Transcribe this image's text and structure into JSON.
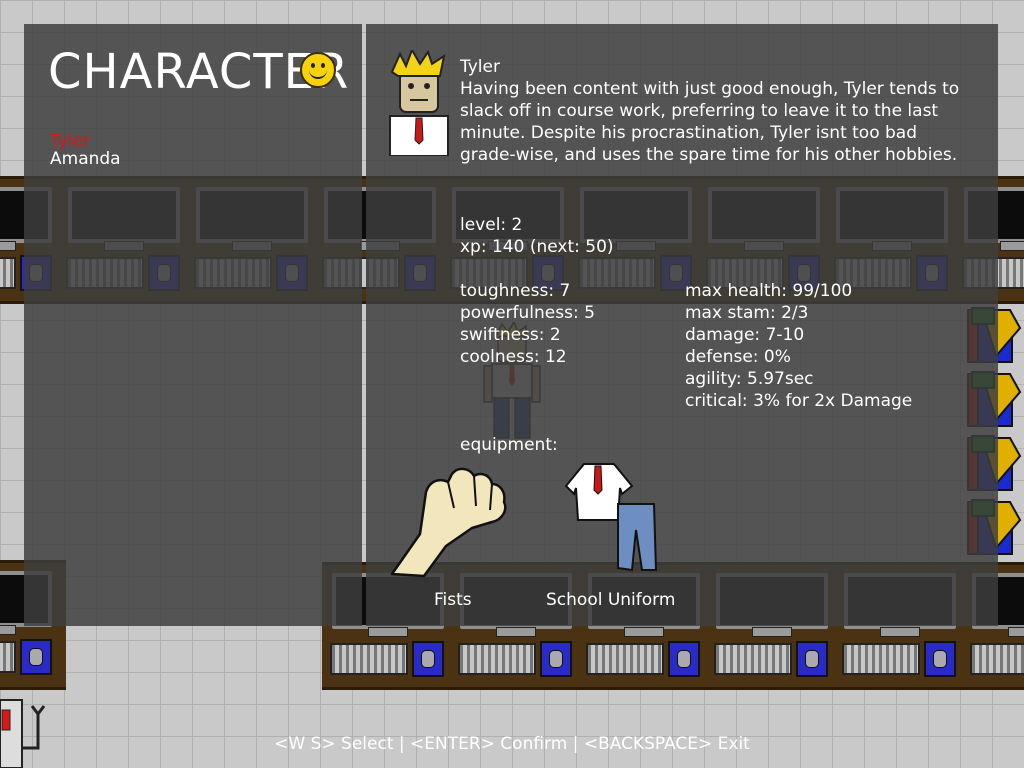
{
  "title": "CHARACTER",
  "characters": {
    "selected": "Tyler",
    "other": "Amanda"
  },
  "profile": {
    "name": "Tyler",
    "description": "Having been content with just good enough, Tyler tends to slack off in course work, preferring to leave it to the last minute. Despite his procrastination, Tyler isnt too bad grade-wise, and uses the spare time for his other hobbies."
  },
  "progress": {
    "level": "level: 2",
    "xp": "xp: 140 (next: 50)"
  },
  "attributes": [
    "toughness: 7",
    "powerfulness: 5",
    "swiftness: 2",
    "coolness: 12"
  ],
  "stats": [
    "max health: 99/100",
    "max stam: 2/3",
    "damage: 7-10",
    "defense: 0%",
    "agility: 5.97sec",
    "critical: 3% for 2x Damage"
  ],
  "equipment": {
    "heading": "equipment:",
    "items": [
      {
        "label": "Fists",
        "icon": "fist-icon"
      },
      {
        "label": "School Uniform",
        "icon": "school-uniform-icon"
      }
    ]
  },
  "footer": "<W S> Select | <ENTER> Confirm | <BACKSPACE> Exit",
  "colors": {
    "selected_character": "#d81818",
    "panel": "#3e3e3e",
    "desk": "#4a3212"
  }
}
